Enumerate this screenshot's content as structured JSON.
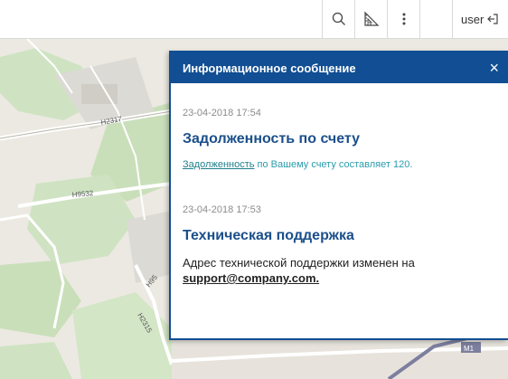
{
  "toolbar": {
    "search_icon": "search-icon",
    "ruler_icon": "ruler-icon",
    "menu_icon": "more-vertical-icon",
    "user_label": "user",
    "logout_icon": "logout-icon"
  },
  "map": {
    "road_labels": [
      "H2317",
      "H9532",
      "H95",
      "H2315",
      "M1"
    ]
  },
  "panel": {
    "title": "Информационное сообщение",
    "close_symbol": "×",
    "messages": [
      {
        "timestamp": "23-04-2018 17:54",
        "title": "Задолженность по счету",
        "link_text": "Задолженность",
        "text_rest": " по Вашему счету составляет 120."
      },
      {
        "timestamp": "23-04-2018 17:53",
        "title": "Техническая поддержка",
        "text_lead": "Адрес технической поддержки изменен на ",
        "link_text": "support@company.com."
      }
    ]
  },
  "colors": {
    "panel_header": "#114e93",
    "title_blue": "#1b4f8b",
    "link_teal": "#2a9cab"
  }
}
